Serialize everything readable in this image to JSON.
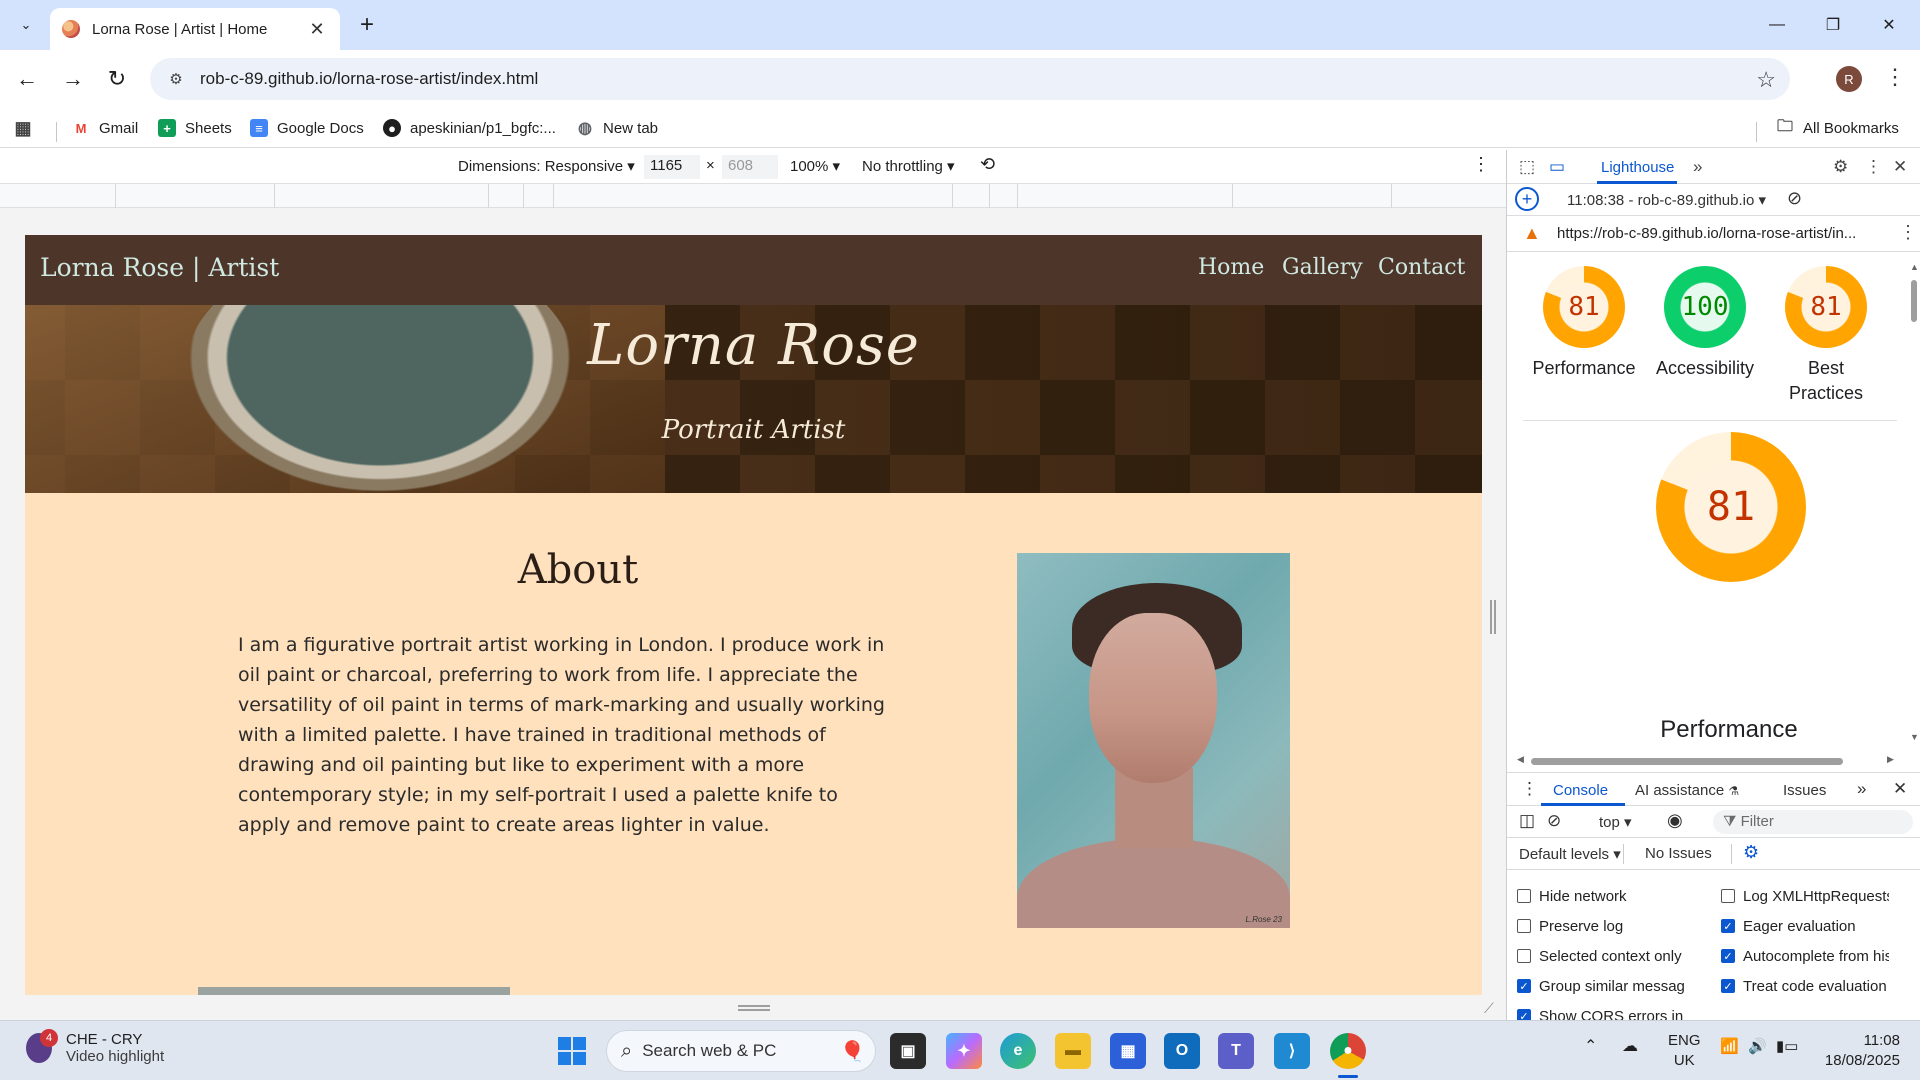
{
  "browser": {
    "tab_title": "Lorna Rose | Artist | Home",
    "url": "rob-c-89.github.io/lorna-rose-artist/index.html",
    "profile_initial": "R",
    "bookmarks": [
      {
        "label": "Gmail",
        "icon": "gmail-icon",
        "color": "#ea4335"
      },
      {
        "label": "Sheets",
        "icon": "sheets-icon",
        "color": "#0f9d58"
      },
      {
        "label": "Google Docs",
        "icon": "docs-icon",
        "color": "#4285f4"
      },
      {
        "label": "apeskinian/p1_bgfc:...",
        "icon": "github-icon",
        "color": "#1f1f1f"
      },
      {
        "label": "New tab",
        "icon": "globe-icon",
        "color": "#5f6368"
      }
    ],
    "all_bookmarks": "All Bookmarks"
  },
  "device_toolbar": {
    "dimensions": "Dimensions: Responsive",
    "width": "1165",
    "times": "×",
    "height": "608",
    "zoom": "100%",
    "throttling": "No throttling"
  },
  "site": {
    "brand": "Lorna Rose | Artist",
    "nav": [
      "Home",
      "Gallery",
      "Contact"
    ],
    "hero_title": "Lorna Rose",
    "hero_subtitle": "Portrait Artist",
    "about_title": "About",
    "about_text": "I am a figurative portrait artist working in London. I produce work in oil paint or charcoal, preferring to work from life. I appreciate the versatility of oil paint in terms of mark-marking and usually working with a limited palette. I have trained in traditional methods of drawing and oil painting but like to experiment with a more contemporary style; in my self-portrait I used a palette knife to apply and remove paint to create areas lighter in value.",
    "portrait_signature": "L.Rose 23"
  },
  "devtools": {
    "active_tab": "Lighthouse",
    "report_time": "11:08:38 - rob-c-89.github.io",
    "report_url": "https://rob-c-89.github.io/lorna-rose-artist/in...",
    "scores": [
      {
        "label": "Performance",
        "value": "81",
        "color": "#ffa400",
        "text_color": "#c33300"
      },
      {
        "label": "Accessibility",
        "value": "100",
        "color": "#0cce6b",
        "text_color": "#008800"
      },
      {
        "label": "Best Practices",
        "value": "81",
        "color": "#ffa400",
        "text_color": "#c33300"
      }
    ],
    "main_score": {
      "label": "Performance",
      "value": "81"
    },
    "drawer_tabs": [
      "Console",
      "AI assistance",
      "Issues"
    ],
    "context": "top",
    "filter_placeholder": "Filter",
    "levels": "Default levels",
    "issues": "No Issues",
    "options_left": [
      {
        "label": "Hide network",
        "checked": false
      },
      {
        "label": "Preserve log",
        "checked": false
      },
      {
        "label": "Selected context only",
        "checked": false
      },
      {
        "label": "Group similar messages i...",
        "checked": true
      },
      {
        "label": "Show CORS errors in con...",
        "checked": true
      }
    ],
    "options_right": [
      {
        "label": "Log XMLHttpRequests",
        "checked": false
      },
      {
        "label": "Eager evaluation",
        "checked": true
      },
      {
        "label": "Autocomplete from hist...",
        "checked": true
      },
      {
        "label": "Treat code evaluation as ...",
        "checked": true
      }
    ]
  },
  "taskbar": {
    "weather_line1": "CHE - CRY",
    "weather_line2": "Video highlight",
    "weather_badge": "4",
    "search_text": "Search web & PC",
    "lang1": "ENG",
    "lang2": "UK",
    "time": "11:08",
    "date": "18/08/2025"
  }
}
